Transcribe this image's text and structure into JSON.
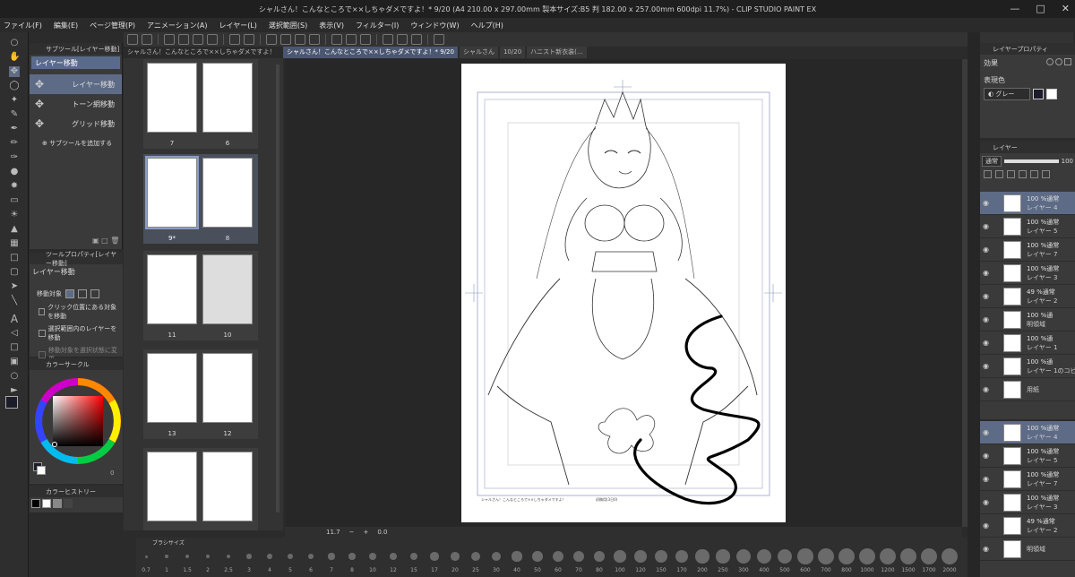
{
  "window": {
    "title": "シャルさん！こんなところで××しちゃダメですよ！* 9/20 (A4 210.00 x 297.00mm 製本サイズ:B5 判 182.00 x 257.00mm 600dpi 11.7%) - CLIP STUDIO PAINT EX"
  },
  "menu": {
    "items": [
      "ファイル(F)",
      "編集(E)",
      "ページ管理(P)",
      "アニメーション(A)",
      "レイヤー(L)",
      "選択範囲(S)",
      "表示(V)",
      "フィルター(I)",
      "ウィンドウ(W)",
      "ヘルプ(H)"
    ]
  },
  "subtool": {
    "header": "サブツール[レイヤー移動]",
    "group": "レイヤー移動",
    "items": [
      "レイヤー移動",
      "トーン網移動",
      "グリッド移動"
    ],
    "add": "サブツールを追加する"
  },
  "toolprop": {
    "header": "ツールプロパティ[レイヤー移動]",
    "name": "レイヤー移動",
    "target_label": "移動対象",
    "options": [
      "クリック位置にある対象を移動",
      "選択範囲内のレイヤーを移動",
      "移動対象を選択状態に変更"
    ]
  },
  "color": {
    "header": "カラーサークル",
    "history_header": "カラーヒストリー",
    "main_color": "#1c1c2a",
    "sub_color": "#ffffff",
    "picked": "#c0101a",
    "value_hint": "0"
  },
  "pages": {
    "tab": "シャルさん！こんなところで××しちゃダメですよ！",
    "spreads": [
      {
        "left": "7",
        "right": "6"
      },
      {
        "left": "9*",
        "right": "8"
      },
      {
        "left": "11",
        "right": "10"
      },
      {
        "left": "13",
        "right": "12"
      },
      {
        "left": "",
        "right": ""
      }
    ]
  },
  "doctabs": [
    "シャルさん！こんなところで××しちゃダメですよ！* 9/20",
    "シャルさん",
    "10/20",
    "ハニスト新衣装(…"
  ],
  "canvas": {
    "footer_left": "シャルさん！こんなところで××しちゃダメですよ！",
    "footer_center": "初稿用(3日0)"
  },
  "status": {
    "zoom": "11.7",
    "angle": "0.0"
  },
  "brush": {
    "header": "ブラシサイズ",
    "sizes": [
      "0.7",
      "1",
      "1.5",
      "2",
      "2.5",
      "3",
      "4",
      "5",
      "6",
      "7",
      "8",
      "10",
      "12",
      "15",
      "17",
      "20",
      "25",
      "30",
      "40",
      "50",
      "60",
      "70",
      "80",
      "100",
      "120",
      "150",
      "170",
      "200",
      "250",
      "300",
      "400",
      "500",
      "600",
      "700",
      "800",
      "1000",
      "1200",
      "1500",
      "1700",
      "2000"
    ]
  },
  "property": {
    "header": "レイヤープロパティ",
    "effect": "効果",
    "expr_label": "表現色",
    "expr_value": "グレー"
  },
  "layers": {
    "header": "レイヤー",
    "blend": "通常",
    "opacity": "100",
    "list": [
      {
        "mode": "100 %通常",
        "name": "レイヤー 4",
        "sel": true
      },
      {
        "mode": "100 %通常",
        "name": "レイヤー 5",
        "sel": false
      },
      {
        "mode": "100 %通常",
        "name": "レイヤー 7",
        "sel": false
      },
      {
        "mode": "100 %通常",
        "name": "レイヤー 3",
        "sel": false
      },
      {
        "mode": "49 %通常",
        "name": "レイヤー 2",
        "sel": false
      },
      {
        "mode": "100 %通",
        "name": "明領域",
        "sel": false
      },
      {
        "mode": "100 %通",
        "name": "レイヤー 1",
        "sel": false
      },
      {
        "mode": "100 %通",
        "name": "レイヤー 1のコピー",
        "sel": false
      },
      {
        "mode": "",
        "name": "用紙",
        "sel": false
      }
    ],
    "list2": [
      {
        "mode": "100 %通常",
        "name": "レイヤー 4",
        "sel": true
      },
      {
        "mode": "100 %通常",
        "name": "レイヤー 5",
        "sel": false
      },
      {
        "mode": "100 %通常",
        "name": "レイヤー 7",
        "sel": false
      },
      {
        "mode": "100 %通常",
        "name": "レイヤー 3",
        "sel": false
      },
      {
        "mode": "49 %通常",
        "name": "レイヤー 2",
        "sel": false
      },
      {
        "mode": "",
        "name": "明領域",
        "sel": false
      }
    ]
  }
}
